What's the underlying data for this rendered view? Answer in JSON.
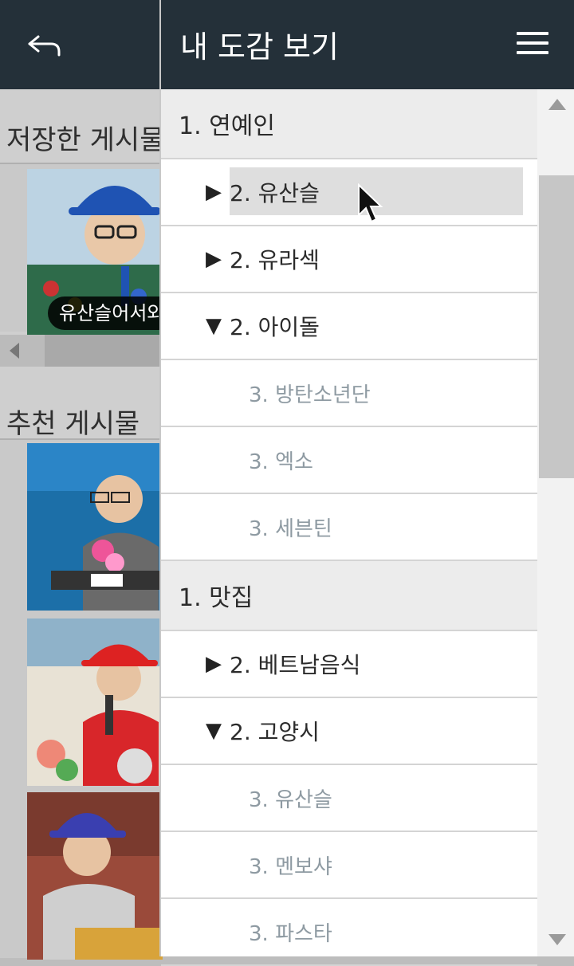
{
  "header": {
    "title": "내 도감 보기"
  },
  "left": {
    "saved_title": "저장한 게시물",
    "saved_caption": "유산슬어서와",
    "recommended_title": "추천 게시물"
  },
  "tree": [
    {
      "level": 1,
      "label": "1. 연예인"
    },
    {
      "level": 2,
      "label": "2. 유산슬",
      "marker": "▶",
      "selected": true
    },
    {
      "level": 2,
      "label": "2. 유라섹",
      "marker": "▶"
    },
    {
      "level": 2,
      "label": "2. 아이돌",
      "marker": "▼"
    },
    {
      "level": 3,
      "label": "3. 방탄소년단"
    },
    {
      "level": 3,
      "label": "3. 엑소"
    },
    {
      "level": 3,
      "label": "3. 세븐틴"
    },
    {
      "level": 1,
      "label": "1. 맛집"
    },
    {
      "level": 2,
      "label": "2. 베트남음식",
      "marker": "▶"
    },
    {
      "level": 2,
      "label": "2. 고양시",
      "marker": "▼"
    },
    {
      "level": 3,
      "label": "3. 유산슬"
    },
    {
      "level": 3,
      "label": "3. 멘보샤"
    },
    {
      "level": 3,
      "label": "3. 파스타"
    }
  ],
  "colors": {
    "header_bg": "#243039",
    "l1_bg": "#ececec",
    "l3_text": "#8e9aa2"
  }
}
